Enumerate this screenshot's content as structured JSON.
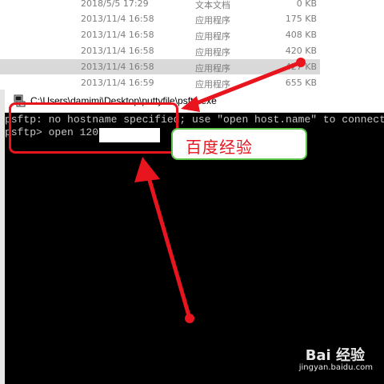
{
  "file_list": {
    "rows": [
      {
        "date": "2018/5/5 17:29",
        "type": "文本文档",
        "size": "0 KB",
        "selected": false
      },
      {
        "date": "2013/11/4 16:58",
        "type": "应用程序",
        "size": "175 KB",
        "selected": false
      },
      {
        "date": "2013/11/4 16:58",
        "type": "应用程序",
        "size": "408 KB",
        "selected": false
      },
      {
        "date": "2013/11/4 16:58",
        "type": "应用程序",
        "size": "420 KB",
        "selected": false
      },
      {
        "date": "2013/11/4 16:58",
        "type": "应用程序",
        "size": "427 KB",
        "selected": true
      },
      {
        "date": "2013/11/4 16:59",
        "type": "应用程序",
        "size": "655 KB",
        "selected": false
      }
    ]
  },
  "console": {
    "title": "C:\\Users\\damimi\\Desktop\\puttyfile\\psftp.exe",
    "lines": [
      "psftp: no hostname specified; use \"open host.name\" to connect",
      "psftp> open 120."
    ],
    "icon": "putty-icon"
  },
  "annotation": {
    "label": "百度经验",
    "colors": {
      "red": "#e8141e",
      "green": "#5cc44a"
    }
  },
  "watermark": {
    "logo": "Bai 经验",
    "url": "jingyan.baidu.com"
  }
}
